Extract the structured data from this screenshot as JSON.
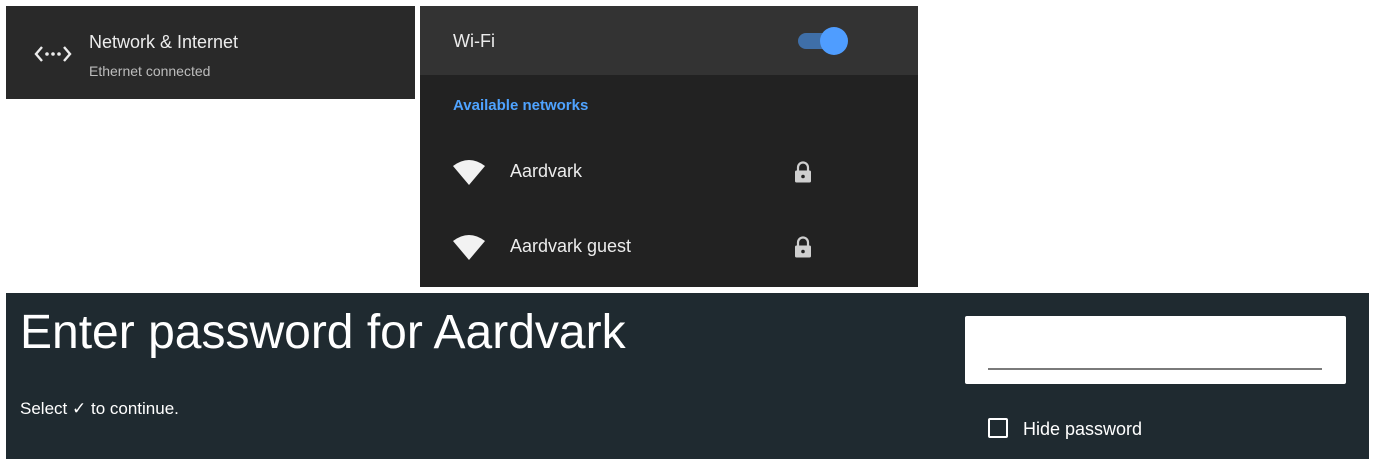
{
  "network_card": {
    "title": "Network & Internet",
    "subtitle": "Ethernet connected",
    "icon": "ethernet-icon"
  },
  "wifi": {
    "title": "Wi-Fi",
    "toggle_on": true,
    "section_label": "Available networks",
    "networks": [
      {
        "name": "Aardvark",
        "icon": "wifi-icon",
        "secured": true
      },
      {
        "name": "Aardvark guest",
        "icon": "wifi-icon",
        "secured": true
      }
    ]
  },
  "password_dialog": {
    "title": "Enter password for Aardvark",
    "hint_prefix": "Select",
    "hint_check": "✓",
    "hint_suffix": "to continue.",
    "password_value": "",
    "hide_password_label": "Hide password",
    "hide_password_checked": false
  },
  "colors": {
    "accent": "#4f9dff",
    "panel_dark": "#222222",
    "dialog_bg": "#1f2a30"
  }
}
